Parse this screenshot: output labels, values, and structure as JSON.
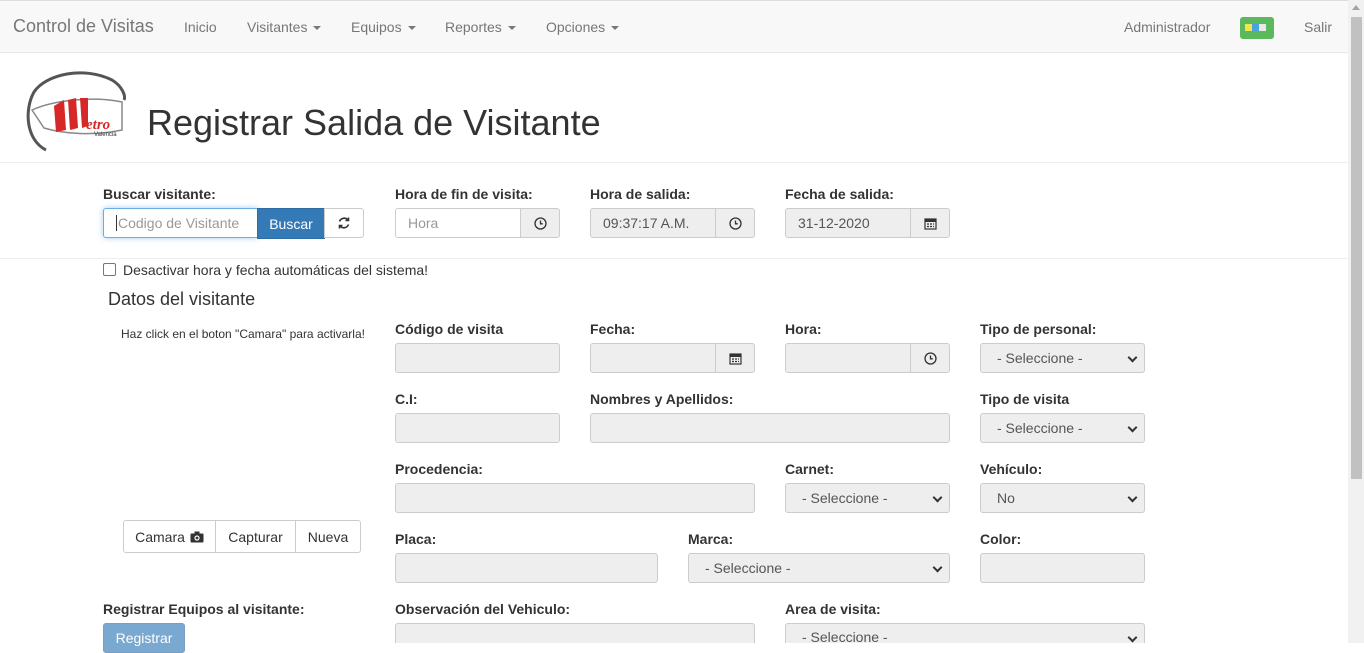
{
  "navbar": {
    "brand": "Control de Visitas",
    "items": [
      "Inicio",
      "Visitantes",
      "Equipos",
      "Reportes",
      "Opciones"
    ],
    "user": "Administrador",
    "logout": "Salir"
  },
  "header": {
    "title": "Registrar Salida de Visitante"
  },
  "search": {
    "label": "Buscar visitante:",
    "placeholder": "Codigo de Visitante",
    "button": "Buscar"
  },
  "times": {
    "end_label": "Hora de fin de visita:",
    "end_placeholder": "Hora",
    "exit_label": "Hora de salida:",
    "exit_value": "09:37:17 A.M.",
    "date_label": "Fecha de salida:",
    "date_value": "31-12-2020"
  },
  "auto_checkbox_label": "Desactivar hora y fecha automáticas del sistema!",
  "section_title": "Datos del visitante",
  "camera": {
    "hint": "Haz click en el boton \"Camara\" para activarla!",
    "camera_button": "Camara",
    "capture_button": "Capturar",
    "new_button": "Nueva"
  },
  "form": {
    "codigo_label": "Código de visita",
    "fecha_label": "Fecha:",
    "hora_label": "Hora:",
    "tipo_personal_label": "Tipo de personal:",
    "tipo_personal_value": "- Seleccione -",
    "ci_label": "C.I:",
    "nombres_label": "Nombres y Apellidos:",
    "tipo_visita_label": "Tipo de visita",
    "tipo_visita_value": "- Seleccione -",
    "procedencia_label": "Procedencia:",
    "carnet_label": "Carnet:",
    "carnet_value": "- Seleccione -",
    "vehiculo_label": "Vehículo:",
    "vehiculo_value": "No",
    "placa_label": "Placa:",
    "marca_label": "Marca:",
    "marca_value": "- Seleccione -",
    "color_label": "Color:",
    "equipos_label": "Registrar Equipos al visitante:",
    "equipos_button": "Registrar",
    "observacion_label": "Observación del Vehiculo:",
    "area_label": "Area de visita:",
    "area_value": "- Seleccione -"
  }
}
